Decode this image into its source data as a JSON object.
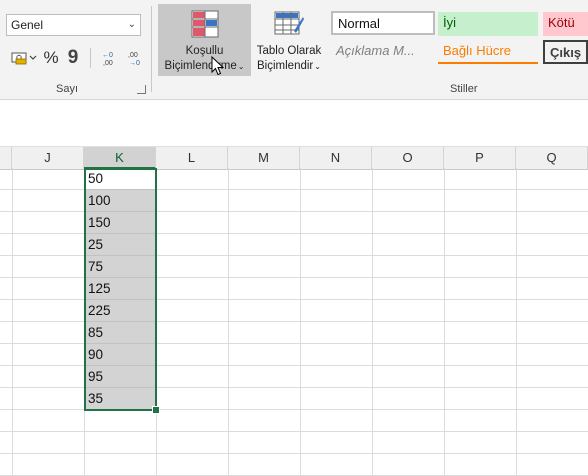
{
  "ribbon": {
    "number_group": {
      "format_value": "Genel",
      "percent_symbol": "%",
      "comma_symbol": "9",
      "increase_decimal": "←0 ,00",
      "decrease_decimal": ",00 →0",
      "label": "Sayı"
    },
    "conditional_formatting": {
      "line1": "Koşullu",
      "line2": "Biçimlendirme"
    },
    "format_as_table": {
      "line1": "Tablo Olarak",
      "line2": "Biçimlendir"
    },
    "styles": {
      "label": "Stiller",
      "normal": "Normal",
      "good": "İyi",
      "bad": "Kötü",
      "explanatory": "Açıklama M...",
      "linked_cell": "Bağlı Hücre",
      "output": "Çıkış"
    },
    "colors": {
      "good_bg": "#c6efce",
      "good_fg": "#006100",
      "bad_bg": "#ffc7ce",
      "bad_fg": "#9c0006",
      "linked_fg": "#fa7d00",
      "accent": "#217346"
    }
  },
  "grid": {
    "columns": [
      "J",
      "K",
      "L",
      "M",
      "N",
      "O",
      "P",
      "Q"
    ],
    "selected_column": "K",
    "k_values": [
      "50",
      "100",
      "150",
      "25",
      "75",
      "125",
      "225",
      "85",
      "90",
      "95",
      "35"
    ]
  }
}
